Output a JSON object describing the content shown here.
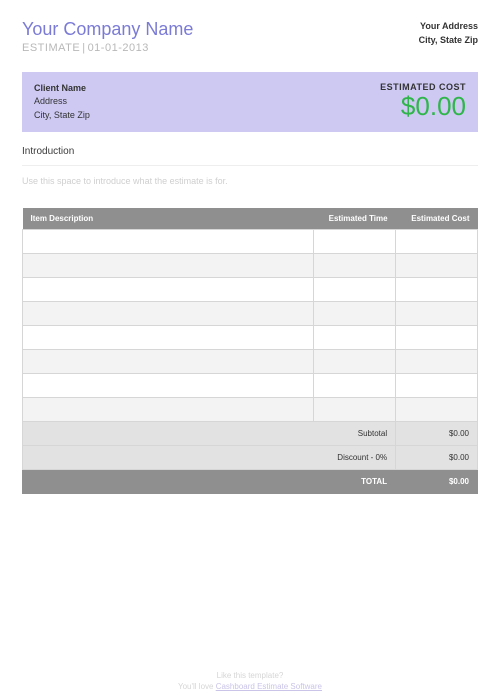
{
  "header": {
    "company_name": "Your Company Name",
    "estimate_label": "ESTIMATE",
    "estimate_date": "01-01-2013",
    "your_address_line1": "Your Address",
    "your_address_line2": "City, State Zip"
  },
  "client": {
    "name": "Client Name",
    "address_line1": "Address",
    "address_line2": "City, State Zip",
    "estimated_cost_label": "ESTIMATED COST",
    "estimated_cost_value": "$0.00"
  },
  "intro": {
    "heading": "Introduction",
    "placeholder": "Use this space to introduce what the estimate is for."
  },
  "table": {
    "columns": {
      "description": "Item Description",
      "time": "Estimated Time",
      "cost": "Estimated Cost"
    },
    "row_count": 8,
    "summary": {
      "subtotal_label": "Subtotal",
      "subtotal_value": "$0.00",
      "discount_label": "Discount - 0%",
      "discount_value": "$0.00",
      "total_label": "TOTAL",
      "total_value": "$0.00"
    }
  },
  "footer": {
    "line1": "Like this template?",
    "line2_prefix": "You'll love ",
    "link_text": "Cashboard Estimate Software"
  }
}
